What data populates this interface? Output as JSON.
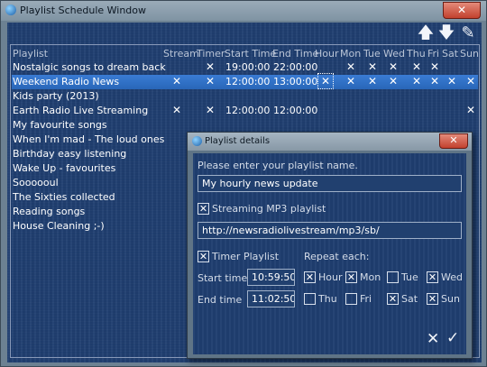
{
  "window": {
    "title": "Playlist Schedule Window",
    "close_glyph": "✕"
  },
  "toolbar": {
    "move_up_glyph": "🡅",
    "move_down_glyph": "🡇",
    "edit_glyph": "✎"
  },
  "columns": [
    "Playlist",
    "Stream",
    "Timer",
    "Start Time",
    "End Time",
    "Hour",
    "Mon",
    "Tue",
    "Wed",
    "Thu",
    "Fri",
    "Sat",
    "Sun"
  ],
  "rows": [
    {
      "name": "Nostalgic songs to dream back",
      "stream": "",
      "timer": "✕",
      "start": "19:00:00",
      "end": "22:00:00",
      "hour": "",
      "mon": "✕",
      "tue": "✕",
      "wed": "✕",
      "thu": "✕",
      "fri": "✕",
      "sat": "",
      "sun": ""
    },
    {
      "name": "Weekend Radio News",
      "stream": "✕",
      "timer": "✕",
      "start": "12:00:00",
      "end": "13:00:00",
      "hour": "✕",
      "mon": "✕",
      "tue": "✕",
      "wed": "✕",
      "thu": "✕",
      "fri": "✕",
      "sat": "✕",
      "sun": "✕"
    },
    {
      "name": "Kids party (2013)",
      "stream": "",
      "timer": "",
      "start": "",
      "end": "",
      "hour": "",
      "mon": "",
      "tue": "",
      "wed": "",
      "thu": "",
      "fri": "",
      "sat": "",
      "sun": ""
    },
    {
      "name": "Earth Radio Live Streaming",
      "stream": "✕",
      "timer": "✕",
      "start": "12:00:00",
      "end": "12:00:00",
      "hour": "",
      "mon": "",
      "tue": "",
      "wed": "",
      "thu": "",
      "fri": "",
      "sat": "",
      "sun": "✕"
    },
    {
      "name": "My favourite songs"
    },
    {
      "name": "When I'm mad - The loud ones"
    },
    {
      "name": "Birthday easy listening"
    },
    {
      "name": "Wake Up - favourites"
    },
    {
      "name": "Soooooul"
    },
    {
      "name": "The Sixties collected"
    },
    {
      "name": "Reading songs"
    },
    {
      "name": "House Cleaning ;-)"
    }
  ],
  "dialog": {
    "title": "Playlist details",
    "close_glyph": "✕",
    "name_prompt": "Please enter your playlist name.",
    "name_value": "My hourly news update",
    "streaming_label": "Streaming MP3 playlist",
    "streaming_checked": "✕",
    "url_value": "http://newsradiolivestream/mp3/sb/",
    "timer_label": "Timer Playlist",
    "timer_checked": "✕",
    "repeat_label": "Repeat each:",
    "start_label": "Start time",
    "start_value": "10:59:50",
    "end_label": "End time",
    "end_value": "11:02:50",
    "days": [
      {
        "label": "Hour",
        "checked": "✕"
      },
      {
        "label": "Mon",
        "checked": "✕"
      },
      {
        "label": "Tue",
        "checked": ""
      },
      {
        "label": "Wed",
        "checked": "✕"
      },
      {
        "label": "Thu",
        "checked": ""
      },
      {
        "label": "Fri",
        "checked": ""
      },
      {
        "label": "Sat",
        "checked": "✕"
      },
      {
        "label": "Sun",
        "checked": "✕"
      }
    ],
    "cancel_glyph": "✕",
    "ok_glyph": "✓"
  }
}
